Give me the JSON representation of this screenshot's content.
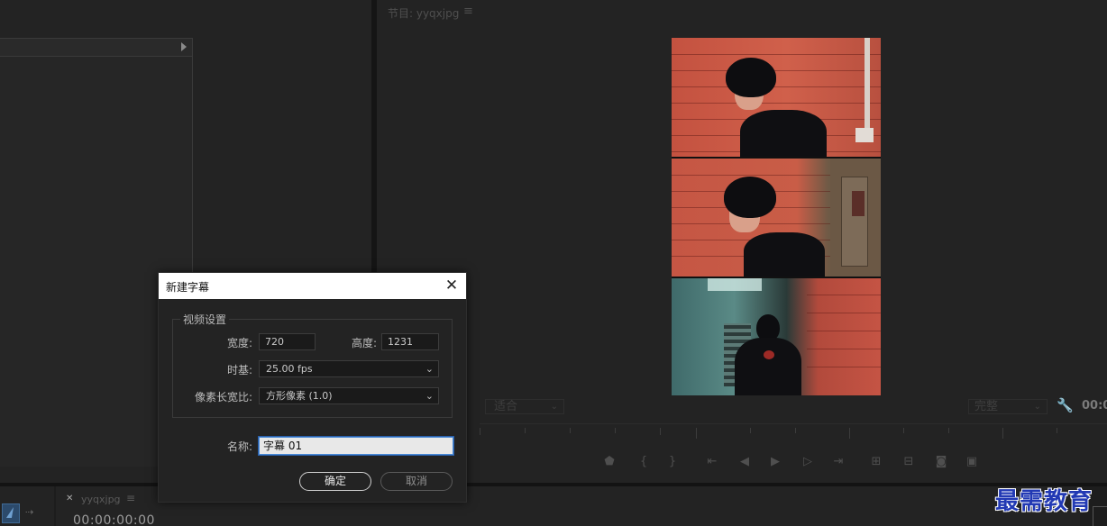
{
  "program_monitor": {
    "title": "节目: yyqxjpg",
    "menu_icon": "≡",
    "fit_label": "适合",
    "quality_label": "完整",
    "timecode_partial": "00:0"
  },
  "timeline": {
    "sequence_name": "yyqxjpg",
    "menu_icon": "≡",
    "timecode": "00:00:00:00"
  },
  "dialog": {
    "title": "新建字幕",
    "video_settings_label": "视频设置",
    "width_label": "宽度:",
    "width_value": "720",
    "height_label": "高度:",
    "height_value": "1231",
    "timebase_label": "时基:",
    "timebase_value": "25.00 fps",
    "pixel_aspect_label": "像素长宽比:",
    "pixel_aspect_value": "方形像素 (1.0)",
    "name_label": "名称:",
    "name_value": "字幕 01",
    "ok_label": "确定",
    "cancel_label": "取消"
  },
  "watermark": "最需教育",
  "colors": {
    "dialog_bg": "#232323",
    "focus_border": "#4a8ad6",
    "watermark": "#2239b4",
    "brick_red": "#c9583f"
  },
  "icons": {
    "close": "✕",
    "wrench": "🔧",
    "dropdown": "⌄"
  }
}
